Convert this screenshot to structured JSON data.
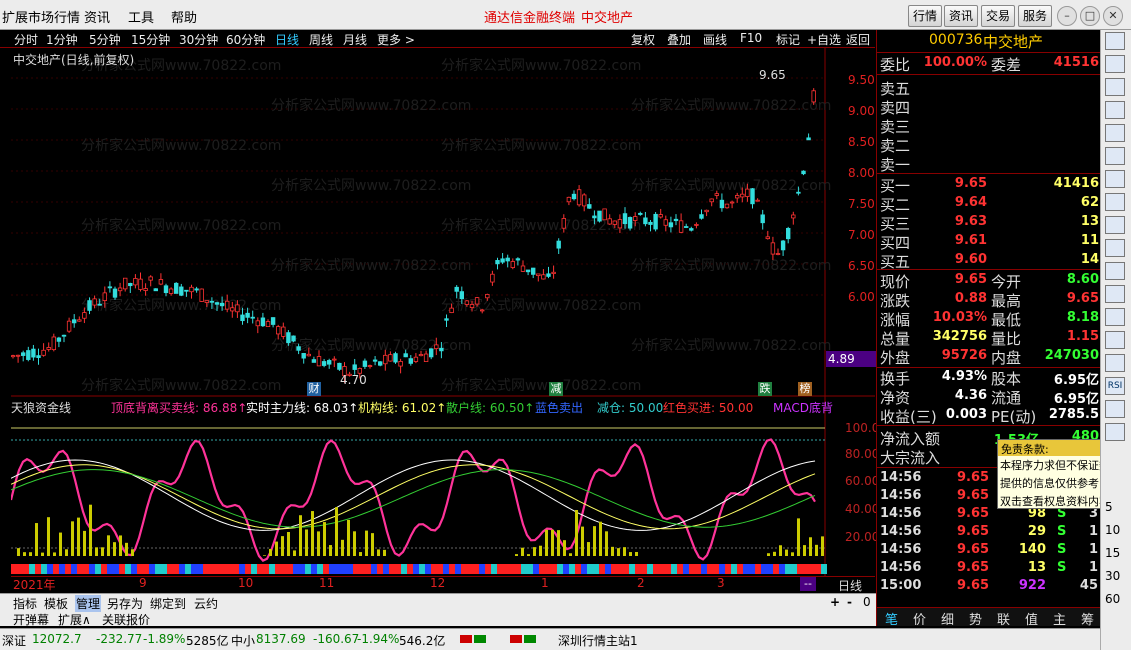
{
  "menu": {
    "items": [
      "扩展市场行情",
      "资讯",
      "工具",
      "帮助"
    ],
    "center_left": "通达信金融终端",
    "center_right": "中交地产",
    "right_btns": [
      "行情",
      "资讯",
      "交易",
      "服务"
    ]
  },
  "periods": [
    "分时",
    "1分钟",
    "5分钟",
    "15分钟",
    "30分钟",
    "60分钟",
    "日线",
    "周线",
    "月线",
    "更多 >"
  ],
  "chart_tools": [
    "复权",
    "叠加",
    "画线",
    "F10",
    "标记",
    "+自选",
    "返回"
  ],
  "chart": {
    "title": "中交地产(日线,前复权)",
    "price_labels": [
      "9.50",
      "9.00",
      "8.50",
      "8.00",
      "7.50",
      "7.00",
      "6.50",
      "6.00"
    ],
    "current_price": "4.89",
    "high_mark": "9.65",
    "low_mark": "4.70",
    "markers": [
      "财",
      "减",
      "跌",
      "榜"
    ]
  },
  "indicator": {
    "name": "天狼资金线",
    "items": [
      {
        "label": "顶底背离买卖线: 86.88↑",
        "color": "#ff3399"
      },
      {
        "label": "实时主力线: 68.03↑",
        "color": "#ffffff"
      },
      {
        "label": "机构线: 61.02↑",
        "color": "#ffff66"
      },
      {
        "label": "散户线: 60.50↑",
        "color": "#33cc33"
      },
      {
        "label": "蓝色卖出",
        "color": "#3366ff"
      },
      {
        "label": "减仓: 50.00",
        "color": "#33cccc"
      },
      {
        "label": "红色买进: 50.00",
        "color": "#ff3333"
      },
      {
        "label": "MACD底背",
        "color": "#cc33ff"
      }
    ],
    "levels": [
      "100.00",
      "80.00",
      "60.00",
      "40.00",
      "20.00"
    ]
  },
  "time_axis": [
    "2021年",
    "9",
    "10",
    "11",
    "12",
    "1",
    "2",
    "3",
    "--"
  ],
  "time_axis_right": "日线",
  "zoom": [
    "+",
    "-",
    "0"
  ],
  "bottom_tabs_row1": [
    "指标",
    "模板",
    "管理",
    "另存为",
    "绑定到",
    "云约"
  ],
  "bottom_tabs_row2": [
    "开弹幕",
    "扩展∧",
    "关联报价"
  ],
  "quote": {
    "code": "000736",
    "name": "中交地产",
    "weibi": {
      "label": "委比",
      "value": "100.00%",
      "label2": "委差",
      "value2": "41516"
    },
    "sells": [
      "卖五",
      "卖四",
      "卖三",
      "卖二",
      "卖一"
    ],
    "buys": [
      {
        "label": "买一",
        "price": "9.65",
        "vol": "41416"
      },
      {
        "label": "买二",
        "price": "9.64",
        "vol": "62"
      },
      {
        "label": "买三",
        "price": "9.63",
        "vol": "13"
      },
      {
        "label": "买四",
        "price": "9.61",
        "vol": "11"
      },
      {
        "label": "买五",
        "price": "9.60",
        "vol": "14"
      }
    ],
    "stats": [
      {
        "k": "现价",
        "v": "9.65",
        "vc": "#ff3333",
        "k2": "今开",
        "v2": "8.60",
        "v2c": "#33ff33"
      },
      {
        "k": "涨跌",
        "v": "0.88",
        "vc": "#ff3333",
        "k2": "最高",
        "v2": "9.65",
        "v2c": "#ff3333"
      },
      {
        "k": "涨幅",
        "v": "10.03%",
        "vc": "#ff3333",
        "k2": "最低",
        "v2": "8.18",
        "v2c": "#33ff33"
      },
      {
        "k": "总量",
        "v": "342756",
        "vc": "#ffff66",
        "k2": "量比",
        "v2": "1.15",
        "v2c": "#ff3333"
      },
      {
        "k": "外盘",
        "v": "95726",
        "vc": "#ff3333",
        "k2": "内盘",
        "v2": "247030",
        "v2c": "#33ff33"
      }
    ],
    "stats2": [
      {
        "k": "换手",
        "v": "4.93%",
        "vc": "#ffffff",
        "k2": "股本",
        "v2": "6.95亿",
        "v2c": "#ffffff"
      },
      {
        "k": "净资",
        "v": "4.36",
        "vc": "#ffffff",
        "k2": "流通",
        "v2": "6.95亿",
        "v2c": "#ffffff"
      },
      {
        "k": "收益(三)",
        "v": "0.003",
        "vc": "#ffffff",
        "k2": "PE(动)",
        "v2": "2785.5",
        "v2c": "#ffffff"
      }
    ],
    "flow": {
      "l1": "净流入额",
      "v1": "1.53亿",
      "v1b": "480",
      "l2": "大宗流入"
    },
    "trades": [
      {
        "t": "14:56",
        "p": "9.65",
        "v": "",
        "d": "",
        "n": ""
      },
      {
        "t": "14:56",
        "p": "9.65",
        "v": "",
        "d": "",
        "n": ""
      },
      {
        "t": "14:56",
        "p": "9.65",
        "v": "98",
        "d": "S",
        "n": "3"
      },
      {
        "t": "14:56",
        "p": "9.65",
        "v": "29",
        "d": "S",
        "n": "1"
      },
      {
        "t": "14:56",
        "p": "9.65",
        "v": "140",
        "d": "S",
        "n": "1"
      },
      {
        "t": "14:56",
        "p": "9.65",
        "v": "13",
        "d": "S",
        "n": "1"
      },
      {
        "t": "15:00",
        "p": "9.65",
        "v": "922",
        "d": "",
        "n": "45"
      }
    ],
    "tabs": [
      "笔",
      "价",
      "细",
      "势",
      "联",
      "值",
      "主",
      "筹"
    ]
  },
  "tooltip": {
    "title": "免责条款:",
    "lines": [
      "本程序力求但不保证数据",
      "提供的信息仅供参考",
      "双击查看权息资料内容"
    ]
  },
  "rtoolbar": {
    "icons": [
      "RSI"
    ],
    "nums": [
      "5",
      "10",
      "15",
      "30",
      "60"
    ]
  },
  "status": {
    "items": [
      {
        "t": "深证",
        "c": "#000"
      },
      {
        "t": "12072.7",
        "c": "#008000"
      },
      {
        "t": "-232.77",
        "c": "#008000"
      },
      {
        "t": "-1.89%",
        "c": "#008000"
      },
      {
        "t": "5285亿",
        "c": "#000"
      },
      {
        "t": "中小",
        "c": "#000"
      },
      {
        "t": "8137.69",
        "c": "#008000"
      },
      {
        "t": "-160.67",
        "c": "#008000"
      },
      {
        "t": "-1.94%",
        "c": "#008000"
      },
      {
        "t": "546.2亿",
        "c": "#000"
      },
      {
        "t": "深圳行情主站1",
        "c": "#000"
      }
    ]
  },
  "watermark": "分析家公式网www.70822.com"
}
